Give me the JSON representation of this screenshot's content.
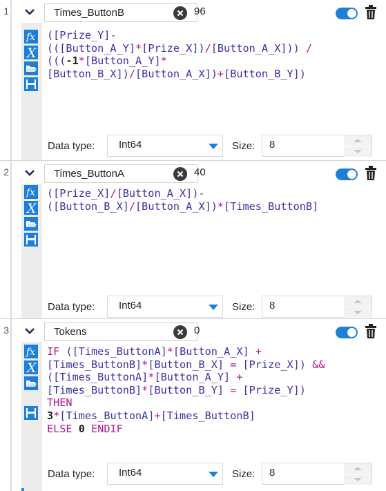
{
  "colors": {
    "accent": "#1e7fd6",
    "keyword": "#b0198f",
    "field_ref": "#3d2fa8",
    "sidebar_bg": "#ececec",
    "clear_btn": "#3a3a3a"
  },
  "icons": {
    "expand": "chevron-down-icon",
    "clear": "close-circle-icon",
    "toggle": "toggle-switch",
    "delete": "trash-icon",
    "functions": "fx-icon",
    "variables": "x-variable-icon",
    "open": "folder-open-icon",
    "save": "save-icon"
  },
  "labels": {
    "data_type": "Data type:",
    "size": "Size:"
  },
  "formulas": [
    {
      "index": "1",
      "name": "Times_ButtonB",
      "result": "96",
      "enabled": true,
      "expression": "([Prize_Y]-\n(([Button_A_Y]*[Prize_X])/[Button_A_X])) /\n(((-1*[Button_A_Y]*\n[Button_B_X])/[Button_A_X])+[Button_B_Y])",
      "data_type": "Int64",
      "size": "8"
    },
    {
      "index": "2",
      "name": "Times_ButtonA",
      "result": "40",
      "enabled": true,
      "expression": "([Prize_X]/[Button_A_X])-\n([Button_B_X]/[Button_A_X])*[Times_ButtonB]",
      "data_type": "Int64",
      "size": "8"
    },
    {
      "index": "3",
      "name": "Tokens",
      "result": "0",
      "enabled": true,
      "expression": "IF ([Times_ButtonA]*[Button_A_X] +\n[Times_ButtonB]*[Button_B_X] = [Prize_X]) &&\n([Times_ButtonA]*[Button_A_Y] +\n[Times_ButtonB]*[Button_B_Y] = [Prize_Y])\nTHEN\n3*[Times_ButtonA]+[Times_ButtonB]\nELSE 0 ENDIF",
      "data_type": "Int64",
      "size": "8"
    }
  ]
}
